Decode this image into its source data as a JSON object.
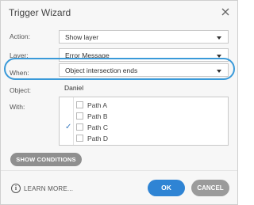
{
  "dialog": {
    "title": "Trigger Wizard",
    "close_icon": "close-icon"
  },
  "fields": {
    "action": {
      "label": "Action:",
      "value": "Show layer"
    },
    "layer": {
      "label": "Layer:",
      "value": "Error Message"
    },
    "when": {
      "label": "When:",
      "value": "Object intersection ends"
    },
    "object": {
      "label": "Object:",
      "value": "Daniel"
    },
    "with": {
      "label": "With:"
    }
  },
  "paths": [
    {
      "label": "Path A",
      "selected": false
    },
    {
      "label": "Path B",
      "selected": false
    },
    {
      "label": "Path C",
      "selected": true
    },
    {
      "label": "Path D",
      "selected": false
    }
  ],
  "buttons": {
    "show_conditions": "SHOW CONDITIONS",
    "learn_more": "LEARN MORE...",
    "ok": "OK",
    "cancel": "CANCEL"
  },
  "colors": {
    "highlight": "#3a9ad9",
    "primary": "#2f84d4",
    "secondary": "#9b9b9b"
  }
}
